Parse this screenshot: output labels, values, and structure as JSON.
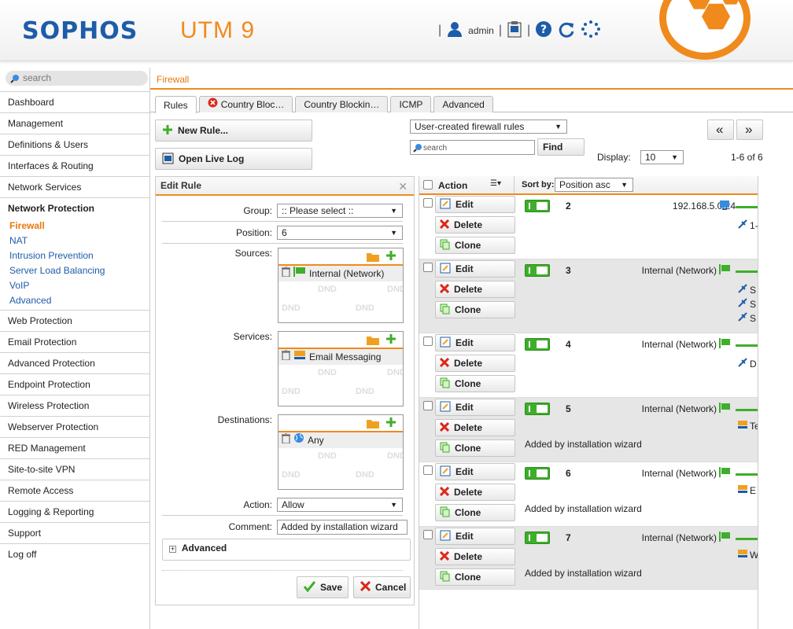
{
  "header": {
    "brand": "SOPHOS",
    "product": "UTM 9",
    "user": "admin",
    "brand_color": "#1d5ca8",
    "accent_color": "#f08a1c"
  },
  "sidebar": {
    "search_placeholder": "search",
    "items": [
      {
        "label": "Dashboard"
      },
      {
        "label": "Management"
      },
      {
        "label": "Definitions & Users"
      },
      {
        "label": "Interfaces & Routing"
      },
      {
        "label": "Network Services"
      },
      {
        "label": "Network Protection",
        "open": true,
        "children": [
          "Firewall",
          "NAT",
          "Intrusion Prevention",
          "Server Load Balancing",
          "VoIP",
          "Advanced"
        ]
      },
      {
        "label": "Web Protection"
      },
      {
        "label": "Email Protection"
      },
      {
        "label": "Advanced Protection"
      },
      {
        "label": "Endpoint Protection"
      },
      {
        "label": "Wireless Protection"
      },
      {
        "label": "Webserver Protection"
      },
      {
        "label": "RED Management"
      },
      {
        "label": "Site-to-site VPN"
      },
      {
        "label": "Remote Access"
      },
      {
        "label": "Logging & Reporting"
      },
      {
        "label": "Support"
      },
      {
        "label": "Log off"
      }
    ]
  },
  "breadcrumb": "Firewall",
  "tabs": [
    "Rules",
    "Country Bloc…",
    "Country Blockin…",
    "ICMP",
    "Advanced"
  ],
  "toolbar": {
    "new_rule": "New Rule...",
    "open_live_log": "Open Live Log",
    "filter_select": "User-created firewall rules",
    "search_placeholder": "search",
    "find": "Find",
    "display_label": "Display:",
    "display_value": "10",
    "pager": "1-6 of 6",
    "prev": "«",
    "next": "»"
  },
  "edit_rule": {
    "title": "Edit Rule",
    "group_label": "Group:",
    "group_value": ":: Please select ::",
    "position_label": "Position:",
    "position_value": "6",
    "sources_label": "Sources:",
    "sources_item": "Internal (Network)",
    "services_label": "Services:",
    "services_item": "Email Messaging",
    "destinations_label": "Destinations:",
    "destinations_item": "Any",
    "dnd": "DND",
    "action_label": "Action:",
    "action_value": "Allow",
    "comment_label": "Comment:",
    "comment_value": "Added by installation wizard",
    "advanced": "Advanced",
    "save": "Save",
    "cancel": "Cancel"
  },
  "list": {
    "action_header": "Action",
    "sortby_label": "Sort by:",
    "sortby_value": "Position asc",
    "buttons": {
      "edit": "Edit",
      "delete": "Delete",
      "clone": "Clone"
    },
    "rows": [
      {
        "position": "2",
        "source": "192.168.5.0/24",
        "comment": "",
        "cut": "1-"
      },
      {
        "position": "3",
        "source": "Internal (Network)",
        "comment": "",
        "cut": "S"
      },
      {
        "position": "4",
        "source": "Internal (Network)",
        "comment": "",
        "cut": "D"
      },
      {
        "position": "5",
        "source": "Internal (Network)",
        "comment": "Added by installation wizard",
        "cut": "Te"
      },
      {
        "position": "6",
        "source": "Internal (Network)",
        "comment": "Added by installation wizard",
        "cut": "E"
      },
      {
        "position": "7",
        "source": "Internal (Network)",
        "comment": "Added by installation wizard",
        "cut": "W"
      }
    ]
  }
}
